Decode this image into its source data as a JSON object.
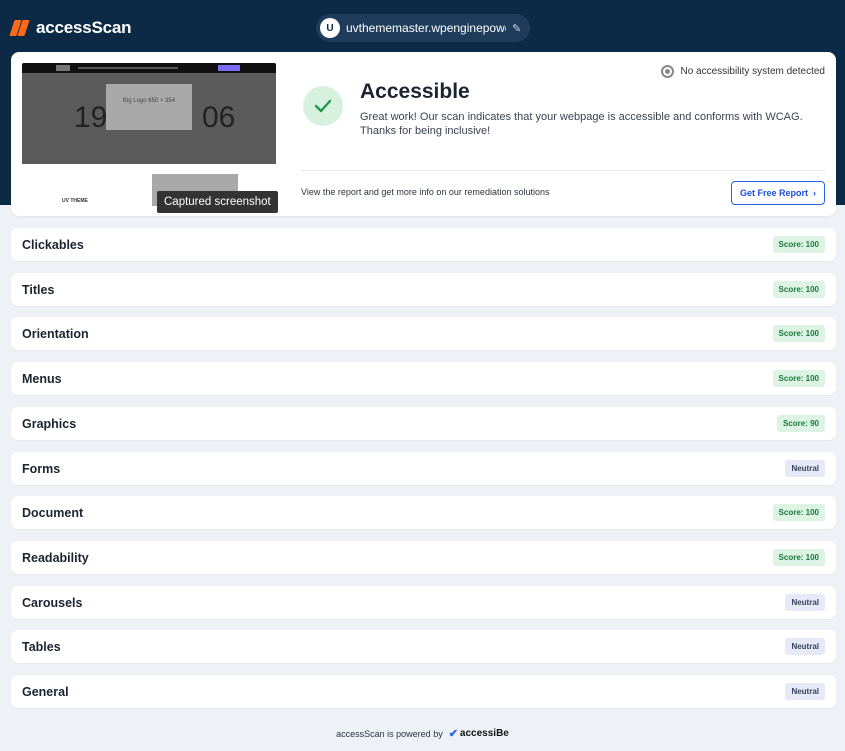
{
  "header": {
    "app_name": "accessScan",
    "url": {
      "avatar_letter": "U",
      "value": "uvthememaster.wpenginepowered.com"
    }
  },
  "result": {
    "screenshot": {
      "caption": "Captured screenshot",
      "hero_number_left": "19",
      "hero_number_right": "06",
      "logo_placeholder": "Big Logo 650 × 354",
      "site_name": "UV THEME"
    },
    "system_status": "No accessibility system detected",
    "verdict": "Accessible",
    "description": "Great work! Our scan indicates that your webpage is accessible and conforms with WCAG. Thanks for being inclusive!",
    "report_text": "View the report and get more info on our remediation solutions",
    "report_button": "Get Free Report",
    "colors": {
      "accent": "#2563eb",
      "success": "#1b7a3c",
      "header": "#0c2a46",
      "brand": "#ff6a1a"
    }
  },
  "categories": [
    {
      "name": "Clickables",
      "badge": "Score: 100",
      "kind": "score"
    },
    {
      "name": "Titles",
      "badge": "Score: 100",
      "kind": "score"
    },
    {
      "name": "Orientation",
      "badge": "Score: 100",
      "kind": "score"
    },
    {
      "name": "Menus",
      "badge": "Score: 100",
      "kind": "score"
    },
    {
      "name": "Graphics",
      "badge": "Score: 90",
      "kind": "score"
    },
    {
      "name": "Forms",
      "badge": "Neutral",
      "kind": "neutral"
    },
    {
      "name": "Document",
      "badge": "Score: 100",
      "kind": "score"
    },
    {
      "name": "Readability",
      "badge": "Score: 100",
      "kind": "score"
    },
    {
      "name": "Carousels",
      "badge": "Neutral",
      "kind": "neutral"
    },
    {
      "name": "Tables",
      "badge": "Neutral",
      "kind": "neutral"
    },
    {
      "name": "General",
      "badge": "Neutral",
      "kind": "neutral"
    }
  ],
  "footer": {
    "text": "accessScan is powered by",
    "brand": "accessiBe"
  }
}
